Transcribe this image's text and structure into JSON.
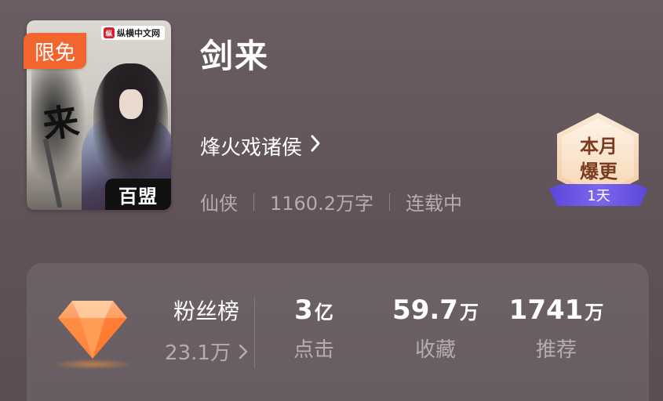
{
  "book": {
    "title": "剑来",
    "author": "烽火戏诸侯",
    "author_chevron": "›",
    "tags": [
      "仙侠",
      "1160.2万字",
      "连载中"
    ]
  },
  "cover": {
    "free_badge": "限免",
    "publisher_logo": "纵",
    "publisher": "纵横中文网",
    "corner_text": "百盟",
    "title_char": "来"
  },
  "month_badge": {
    "line1": "本月",
    "line2": "爆更",
    "ribbon": "1天"
  },
  "stats": {
    "fans_label": "粉丝榜",
    "fans_value": "23.1万",
    "fans_chevron": "›",
    "items": [
      {
        "num": "3",
        "unit": "亿",
        "label": "点击"
      },
      {
        "num": "59.7",
        "unit": "万",
        "label": "收藏"
      },
      {
        "num": "1741",
        "unit": "万",
        "label": "推荐"
      }
    ]
  },
  "icons": {
    "gem": "diamond-icon",
    "chevron": "chevron-right-icon"
  },
  "colors": {
    "free_badge": "#f3652f",
    "ribbon": "#5b47d6",
    "badge_text": "#7a3b1e",
    "gem": "#ff8a3d"
  }
}
